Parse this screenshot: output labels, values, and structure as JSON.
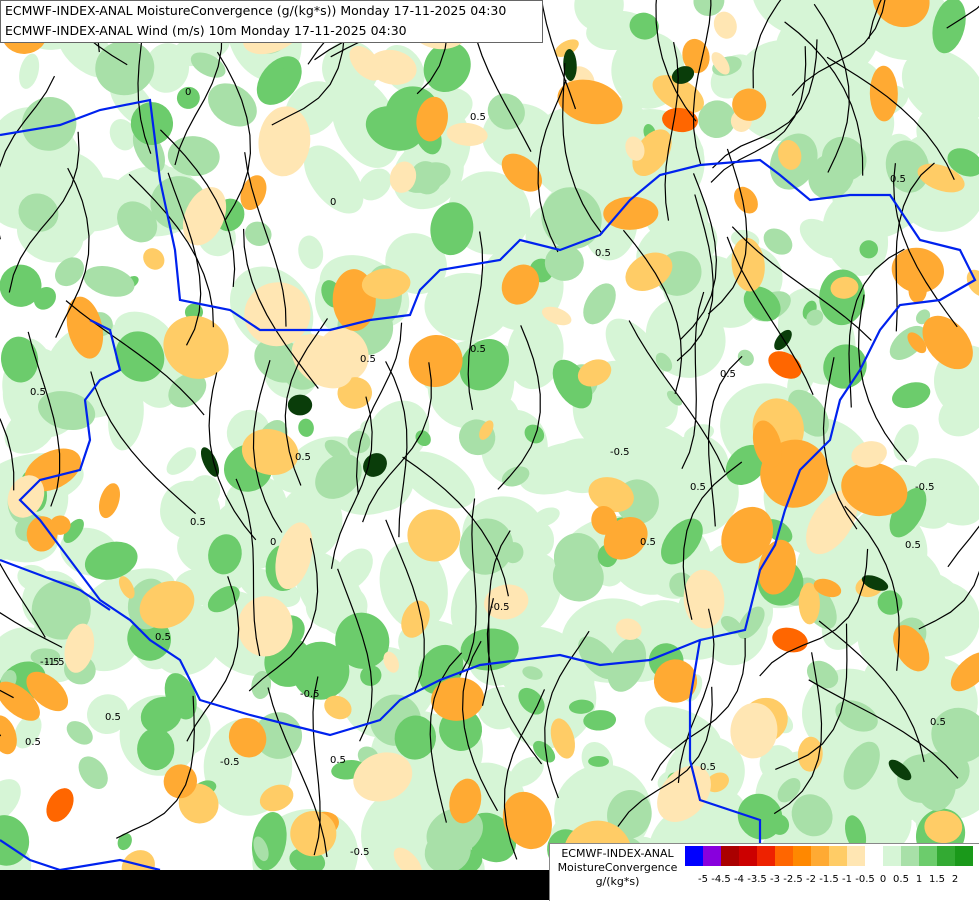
{
  "header": {
    "line1": "ECMWF-INDEX-ANAL MoistureConvergence (g/(kg*s)) Monday 17-11-2025 04:30",
    "line2": "ECMWF-INDEX-ANAL Wind (m/s) 10m Monday 17-11-2025 04:30"
  },
  "legend": {
    "title1": "ECMWF-INDEX-ANAL",
    "title2": "MoistureConvergence",
    "units": "g/(kg*s)",
    "colors": [
      "#0000ff",
      "#8800dd",
      "#aa0000",
      "#cc0000",
      "#ee2200",
      "#ff6600",
      "#ff8800",
      "#ffaa33",
      "#ffcc66",
      "#ffe6b3",
      "#ffffff",
      "#d6f5d6",
      "#a8e0a8",
      "#6ccc6c",
      "#33aa33",
      "#1a991a"
    ],
    "ticks": [
      "-5",
      "-4.5",
      "-4",
      "-3.5",
      "-3",
      "-2.5",
      "-2",
      "-1.5",
      "-1",
      "-0.5",
      "0",
      "0.5",
      "1",
      "1.5",
      "2"
    ]
  },
  "map": {
    "contour_labels": [
      "-0.5",
      "0.5",
      "0",
      "-1.5",
      "0.5",
      "-0.5",
      "0.5",
      "0.5",
      "-0.5",
      "0",
      "-0.5",
      "0.5",
      "0.5",
      "0.5",
      "0.5",
      "-0.5",
      "0.5",
      "0.5",
      "0",
      "0.5",
      "-0.5",
      "0.5",
      "0.5",
      "-1.5",
      "0.5",
      "0.5",
      "0.5",
      "-0.5",
      "0.5",
      "0.5"
    ]
  }
}
